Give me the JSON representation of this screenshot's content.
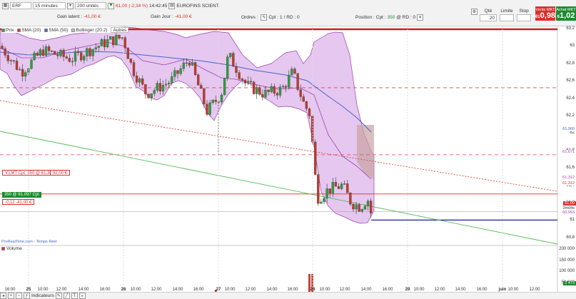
{
  "toolbar": {
    "symbol": "ERF",
    "timeframe": "15 minutes",
    "units": "200 unités",
    "price": "61,00",
    "change": "(-2,34 %)",
    "time": "14:42:45",
    "instrument": "EUROFINS SCIENT.",
    "gain_latent_label": "Gain latent :",
    "gain_latent_value": "-41,00 €",
    "gain_jour_label": "Gain Jour :",
    "gain_jour_value": "-41,00 €",
    "ordres_label": "Ordres :",
    "ordres_cpt": "Cpt : 1",
    "ordres_rd": "/ RD : 0",
    "position_label": "Position :",
    "position_cpt": "Cpt : ",
    "position_qty": "350",
    "position_rd": "@ RD : 0",
    "qte_label": "Qté",
    "qte_value": "20",
    "limite_label": "Limite",
    "stop_label": "Stop",
    "sell_label": "Vente MKT",
    "sell_prefix": "61",
    "sell_price": "0,98",
    "buy_label": "Achat MKT",
    "buy_prefix": "6",
    "buy_price": "1,02"
  },
  "colors": {
    "accent_red": "#d9302a",
    "accent_green": "#1c8a2e",
    "bollinger_fill": "#dcb4ea",
    "sma50": "#4466cc",
    "sma20": "#9b3fb0",
    "trend_green": "#55bb55",
    "trend_red": "#e04444"
  },
  "legend": {
    "prix": "Prix",
    "sma20": "SMA (20)",
    "sma50": "SMA (50)",
    "bollinger": "Bollinger (20.2)",
    "autres": "Autres"
  },
  "order_line": {
    "label": "V.LMT Cpt. 350 @ 61,30",
    "value": "92,00 €"
  },
  "position_line": {
    "label": "350 @ 61,097 Cpt",
    "pl_change": "-0,12",
    "pl_value": "-41,00 €"
  },
  "source_label": "ProRealTime.com - Temps Réel",
  "volume_label": "Volume",
  "y_axis": [
    "63,2",
    "63",
    "62,8",
    "62,6",
    "62,4",
    "62,2",
    "62",
    "61,8",
    "61,6",
    "61,4",
    "61,2",
    "61",
    "60,8"
  ],
  "y_tags": {
    "sma50_value": "61,960",
    "upper_value": "61,671",
    "sma20_a": "61,312",
    "sma20_b": "61,312",
    "price_tag": "61,00",
    "countdown": "2m04s",
    "lower_value": "60,953"
  },
  "volume_axis": [
    "200 000",
    "150 000",
    "100 000",
    "50 000"
  ],
  "volume_tag": "2 473",
  "x_axis": [
    "16:00",
    "25",
    "10:00",
    "12:00",
    "14:00",
    "16:00",
    "26",
    "10:00",
    "12:00",
    "14:00",
    "16:00",
    "27",
    "10:00",
    "12:00",
    "14:00",
    "16:00",
    "28",
    "10:00",
    "12:00",
    "14:00",
    "16:00",
    "29",
    "10:00",
    "12:00",
    "14:00",
    "16:00",
    "juin",
    "10:00",
    "12:00"
  ],
  "bottom_bar": {
    "indicators_label": "Indicateurs"
  }
}
